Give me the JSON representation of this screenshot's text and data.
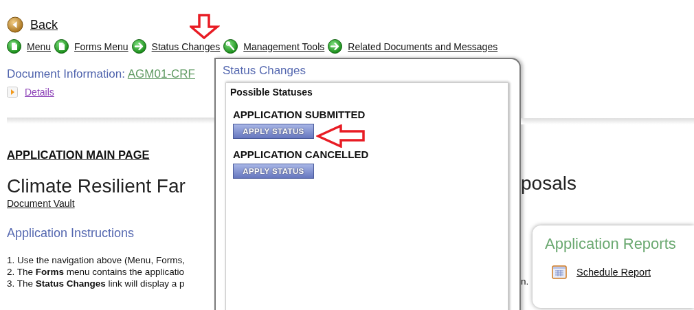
{
  "nav": {
    "back": "Back",
    "links": [
      {
        "label": "Menu",
        "kind": "page"
      },
      {
        "label": "Forms Menu",
        "kind": "page"
      },
      {
        "label": "Status Changes",
        "kind": "arrow"
      },
      {
        "label": "Management Tools",
        "kind": "tool"
      },
      {
        "label": "Related Documents and Messages",
        "kind": "arrow"
      }
    ]
  },
  "document_info": {
    "label": "Document Information:",
    "value": "AGM01-CRF"
  },
  "details_link": "Details",
  "main": {
    "heading": "APPLICATION MAIN PAGE",
    "title_left": "Climate Resilient Far",
    "title_right": "posals",
    "vault_link": "Document Vault",
    "instructions_title": "Application Instructions",
    "instructions": [
      "1. Use the navigation above (Menu, Forms,",
      "2. The **Forms** menu contains the applicatio",
      "3. The **Status Changes** link will display a p"
    ],
    "instructions_right": "n."
  },
  "popup": {
    "title": "Status Changes",
    "section": "Possible Statuses",
    "statuses": [
      {
        "label": "APPLICATION SUBMITTED",
        "button": "APPLY STATUS"
      },
      {
        "label": "APPLICATION CANCELLED",
        "button": "APPLY STATUS"
      }
    ]
  },
  "reports": {
    "title": "Application Reports",
    "links": [
      {
        "label": "Schedule Report"
      }
    ]
  }
}
